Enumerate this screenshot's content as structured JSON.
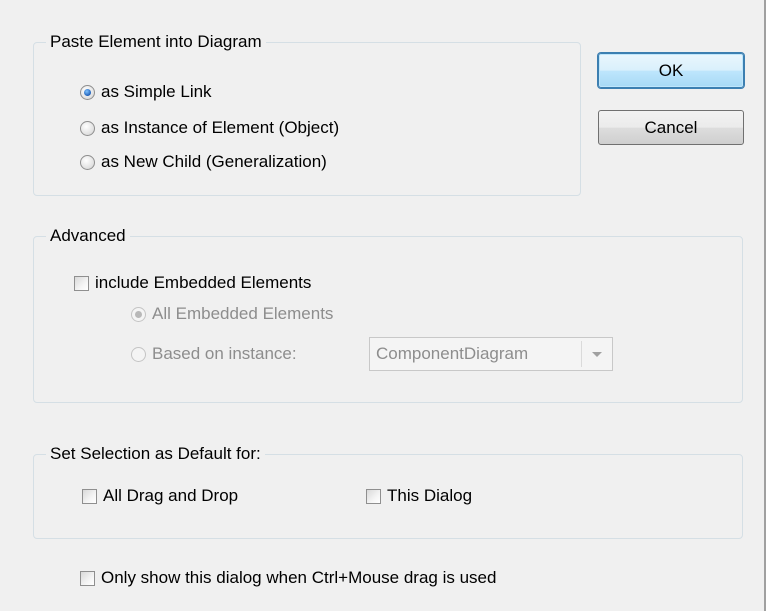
{
  "paste_group": {
    "title": "Paste Element into Diagram",
    "options": [
      {
        "label": "as Simple Link",
        "checked": true
      },
      {
        "label": "as Instance of Element (Object)",
        "checked": false
      },
      {
        "label": "as New Child (Generalization)",
        "checked": false
      }
    ]
  },
  "buttons": {
    "ok": "OK",
    "cancel": "Cancel"
  },
  "advanced_group": {
    "title": "Advanced",
    "include_label": "include Embedded Elements",
    "include_checked": false,
    "all_embedded_label": "All Embedded Elements",
    "based_on_label": "Based on instance:",
    "instance_value": "ComponentDiagram"
  },
  "default_group": {
    "title": "Set Selection as Default for:",
    "drag_drop_label": "All Drag and Drop",
    "this_dialog_label": "This Dialog"
  },
  "footer": {
    "ctrl_drag_label": "Only show this dialog when Ctrl+Mouse drag is used"
  },
  "icons": {
    "dropdown": "chevron-down-icon"
  }
}
